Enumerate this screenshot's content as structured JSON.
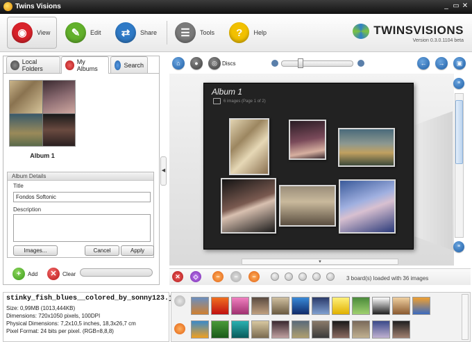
{
  "window": {
    "title": "Twins Visions"
  },
  "toolbar": {
    "items": [
      {
        "label": "View",
        "icon": "view-icon",
        "color": "#d8222a",
        "active": true
      },
      {
        "label": "Edit",
        "icon": "edit-icon",
        "color": "#62b02b"
      },
      {
        "label": "Share",
        "icon": "share-icon",
        "color": "#2f7ac6"
      },
      {
        "label": "Tools",
        "icon": "tools-icon",
        "color": "#7a7a7a"
      },
      {
        "label": "Help",
        "icon": "help-icon",
        "color": "#f2c100"
      }
    ]
  },
  "logo": {
    "brand_a": "TWINS",
    "brand_b": "VISIONS",
    "version": "Version 0.3.0.1104 beta"
  },
  "left_tabs": [
    {
      "label": "Local Folders",
      "icon": "folder-icon",
      "selected": false
    },
    {
      "label": "My Albums",
      "icon": "albums-icon",
      "selected": true
    },
    {
      "label": "Search",
      "icon": "search-icon",
      "selected": false
    }
  ],
  "album": {
    "name": "Album 1"
  },
  "details": {
    "header": "Album Details",
    "title_label": "Title",
    "title_value": "Fondos Softonic",
    "description_label": "Description",
    "description_value": "",
    "images_button": "Images...",
    "cancel_button": "Cancel",
    "apply_button": "Apply"
  },
  "actions": {
    "add_label": "Add",
    "clear_label": "Clear"
  },
  "view_toolbar": {
    "discs_label": "Discs"
  },
  "board": {
    "album_title": "Album 1",
    "album_subtitle": "6 images (Page 1 of 2)",
    "status": "3 board(s) loaded with 36 images"
  },
  "info": {
    "filename": "stinky_fish_blues__colored_by_sonny123.j...",
    "size": "Size: 0,99MB (1013,444KB)",
    "dimensions": "Dimensions: 720x1050 pixels, 100DPI",
    "physical": "Physical Dimensions: 7,2x10,5 inches, 18,3x26,7 cm",
    "pixel_format": "Pixel Format: 24 bits per pixel. (RGB=8,8,8)"
  }
}
